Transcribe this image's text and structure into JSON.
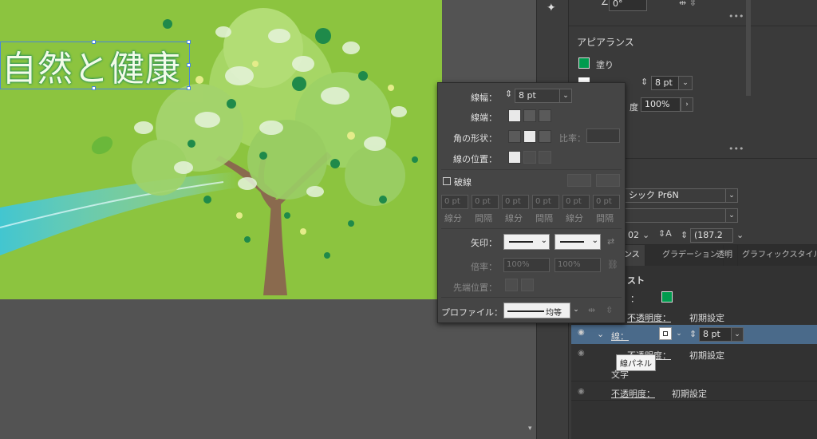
{
  "canvas": {
    "title_text": "自然と健康"
  },
  "top_right_panel": {
    "rotation_value": "0°",
    "appearance_heading": "アピアランス",
    "fill_label": "塗り",
    "stroke_weight": "8 pt",
    "opacity_label_partial": "度",
    "opacity_value": "100%",
    "font_name_partial": "シック Pr6N",
    "size_value_partial": "02",
    "tracking_value": "(187.2"
  },
  "stroke_panel": {
    "weight_label": "線幅：",
    "weight_value": "8 pt",
    "cap_label": "線端：",
    "corner_label": "角の形状：",
    "ratio_label": "比率：",
    "align_label": "線の位置：",
    "dashed_label": "破線",
    "dash_values": [
      "0 pt",
      "0 pt",
      "0 pt",
      "0 pt",
      "0 pt",
      "0 pt"
    ],
    "dash_labels": [
      "線分",
      "間隔",
      "線分",
      "間隔",
      "線分",
      "間隔"
    ],
    "arrow_label": "矢印：",
    "scale_label": "倍率：",
    "scale_values": [
      "100%",
      "100%"
    ],
    "tip_label": "先端位置：",
    "profile_label": "プロファイル：",
    "profile_value": "均等"
  },
  "appearance_panel": {
    "tabs": [
      "アランス",
      "グラデーション",
      "透明",
      "グラフィックスタイル"
    ],
    "text_heading": "スト",
    "fill_colon": "：",
    "opacity_label": "不透明度：",
    "default_value": "初期設定",
    "stroke_label": "線：",
    "stroke_weight": "8 pt",
    "tooltip": "線パネル",
    "text_label": "文字"
  },
  "colors": {
    "canvas_green": "#8cc43f",
    "fill_swatch": "#009b4e",
    "selection_blue": "#4a86d8"
  }
}
